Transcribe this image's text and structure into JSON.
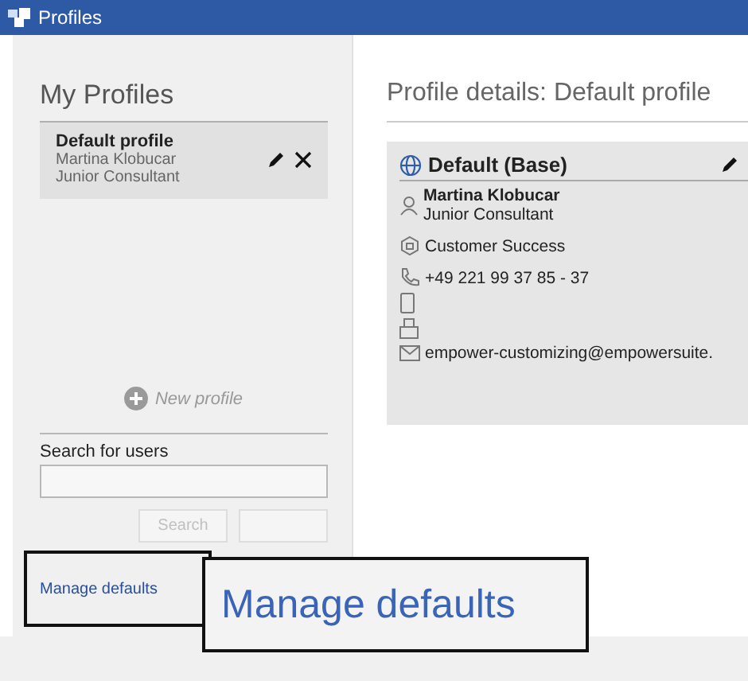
{
  "window": {
    "title": "Profiles"
  },
  "my_profiles": {
    "heading": "My Profiles",
    "profiles": [
      {
        "name": "Default profile",
        "person": "Martina Klobucar",
        "role": "Junior Consultant",
        "selected": true
      }
    ],
    "new_profile": "New profile"
  },
  "search": {
    "label": "Search for users",
    "buttons": [
      {
        "label": "Search",
        "disabled": true
      },
      {
        "disabled": true
      }
    ]
  },
  "manage_defaults": "Manage defaults",
  "callout": {
    "text": "Manage defaults"
  },
  "details": {
    "heading": "Profile details: Default profile",
    "card": {
      "title": "Default (Base)",
      "name": "Martina Klobucar",
      "role": "Junior Consultant",
      "department": "Customer Success",
      "phone": "+49 221 99 37 85 - 37",
      "email": "empower-customizing@empowersuite."
    }
  }
}
